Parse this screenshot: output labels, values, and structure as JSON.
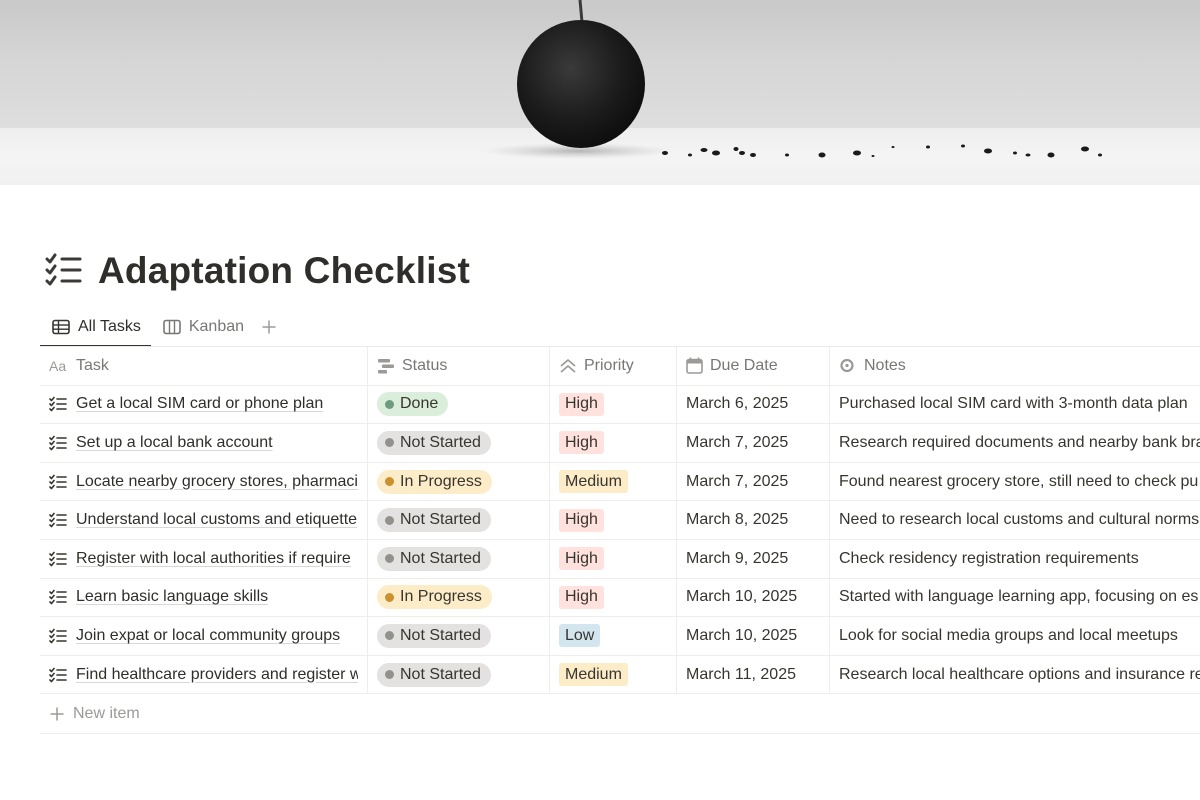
{
  "page": {
    "title": "Adaptation Checklist",
    "icon": "checklist-icon"
  },
  "views": {
    "tabs": [
      {
        "label": "All Tasks",
        "icon": "table-icon",
        "active": true
      },
      {
        "label": "Kanban",
        "icon": "board-icon",
        "active": false
      }
    ],
    "add_view_icon": "plus-icon"
  },
  "table": {
    "columns": [
      {
        "label": "Task",
        "icon": "text-property-icon"
      },
      {
        "label": "Status",
        "icon": "status-property-icon"
      },
      {
        "label": "Priority",
        "icon": "priority-property-icon"
      },
      {
        "label": "Due Date",
        "icon": "calendar-icon"
      },
      {
        "label": "Notes",
        "icon": "notes-property-icon"
      }
    ],
    "rows": [
      {
        "task": "Get a local SIM card or phone plan",
        "status": "Done",
        "priority": "High",
        "due": "March 6, 2025",
        "notes": "Purchased local SIM card with 3-month data plan"
      },
      {
        "task": "Set up a local bank account",
        "status": "Not Started",
        "priority": "High",
        "due": "March 7, 2025",
        "notes": "Research required documents and nearby bank bra"
      },
      {
        "task": "Locate nearby grocery stores, pharmaci",
        "status": "In Progress",
        "priority": "Medium",
        "due": "March 7, 2025",
        "notes": "Found nearest grocery store, still need to check pu"
      },
      {
        "task": "Understand local customs and etiquette",
        "status": "Not Started",
        "priority": "High",
        "due": "March 8, 2025",
        "notes": "Need to research local customs and cultural norms"
      },
      {
        "task": "Register with local authorities if require",
        "status": "Not Started",
        "priority": "High",
        "due": "March 9, 2025",
        "notes": "Check residency registration requirements"
      },
      {
        "task": "Learn basic language skills",
        "status": "In Progress",
        "priority": "High",
        "due": "March 10, 2025",
        "notes": "Started with language learning app, focusing on es"
      },
      {
        "task": "Join expat or local community groups",
        "status": "Not Started",
        "priority": "Low",
        "due": "March 10, 2025",
        "notes": "Look for social media groups and local meetups"
      },
      {
        "task": "Find healthcare providers and register w",
        "status": "Not Started",
        "priority": "Medium",
        "due": "March 11, 2025",
        "notes": "Research local healthcare options and insurance re"
      }
    ],
    "new_item_label": "New item"
  },
  "colors": {
    "status": {
      "Done": {
        "bg": "#dbeddb",
        "dot": "#6c9b7d"
      },
      "Not Started": {
        "bg": "#e3e2e0",
        "dot": "#91918e"
      },
      "In Progress": {
        "bg": "#fdecc8",
        "dot": "#cb912f"
      }
    },
    "priority": {
      "High": "#ffe2dd",
      "Medium": "#fdecc8",
      "Low": "#d3e5ef"
    }
  }
}
